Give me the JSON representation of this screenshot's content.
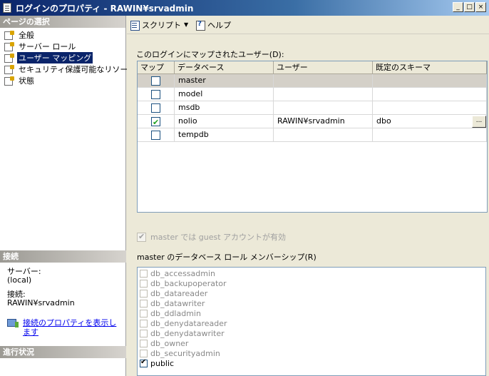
{
  "window": {
    "title": "ログインのプロパティ - RAWIN¥srvadmin",
    "controls": [
      "_",
      "□",
      "×"
    ]
  },
  "left_pane": {
    "page_select_header": "ページの選択",
    "nav_items": [
      {
        "label": "全般",
        "selected": false
      },
      {
        "label": "サーバー ロール",
        "selected": false
      },
      {
        "label": "ユーザー マッピング",
        "selected": true
      },
      {
        "label": "セキュリティ保護可能なリソース",
        "selected": false
      },
      {
        "label": "状態",
        "selected": false
      }
    ],
    "connection_header": "接続",
    "server_label": "サーバー:",
    "server_value": "(local)",
    "connection_label": "接続:",
    "connection_value": "RAWIN¥srvadmin",
    "view_properties_link": "接続のプロパティを表示します",
    "progress_header": "進行状況"
  },
  "toolbar": {
    "script_label": "スクリプト",
    "help_label": "ヘルプ",
    "icons": [
      "script-icon",
      "help-icon"
    ]
  },
  "users_section": {
    "label": "このログインにマップされたユーザー(D):",
    "columns": [
      "マップ",
      "データベース",
      "ユーザー",
      "既定のスキーマ"
    ],
    "rows": [
      {
        "map": false,
        "database": "master",
        "user": "",
        "schema": "",
        "selected": true
      },
      {
        "map": false,
        "database": "model",
        "user": "",
        "schema": "",
        "selected": false
      },
      {
        "map": false,
        "database": "msdb",
        "user": "",
        "schema": "",
        "selected": false
      },
      {
        "map": true,
        "database": "nolio",
        "user": "RAWIN¥srvadmin",
        "schema": "dbo",
        "selected": false
      },
      {
        "map": false,
        "database": "tempdb",
        "user": "",
        "schema": "",
        "selected": false
      }
    ],
    "schema_browse_button": "..."
  },
  "guest_option": {
    "label": "master では guest アカウントが有効",
    "checked": true,
    "enabled": false
  },
  "roles_section": {
    "label": "master のデータベース ロール メンバーシップ(R)",
    "roles": [
      {
        "name": "db_accessadmin",
        "checked": false
      },
      {
        "name": "db_backupoperator",
        "checked": false
      },
      {
        "name": "db_datareader",
        "checked": false
      },
      {
        "name": "db_datawriter",
        "checked": false
      },
      {
        "name": "db_ddladmin",
        "checked": false
      },
      {
        "name": "db_denydatareader",
        "checked": false
      },
      {
        "name": "db_denydatawriter",
        "checked": false
      },
      {
        "name": "db_owner",
        "checked": false
      },
      {
        "name": "db_securityadmin",
        "checked": false
      },
      {
        "name": "public",
        "checked": true
      }
    ]
  },
  "colors": {
    "title_gradient_start": "#0a246a",
    "title_gradient_end": "#a6caf0",
    "selection": "#0a246a",
    "dialog_bg": "#ece9d8",
    "link": "#0000ee"
  }
}
